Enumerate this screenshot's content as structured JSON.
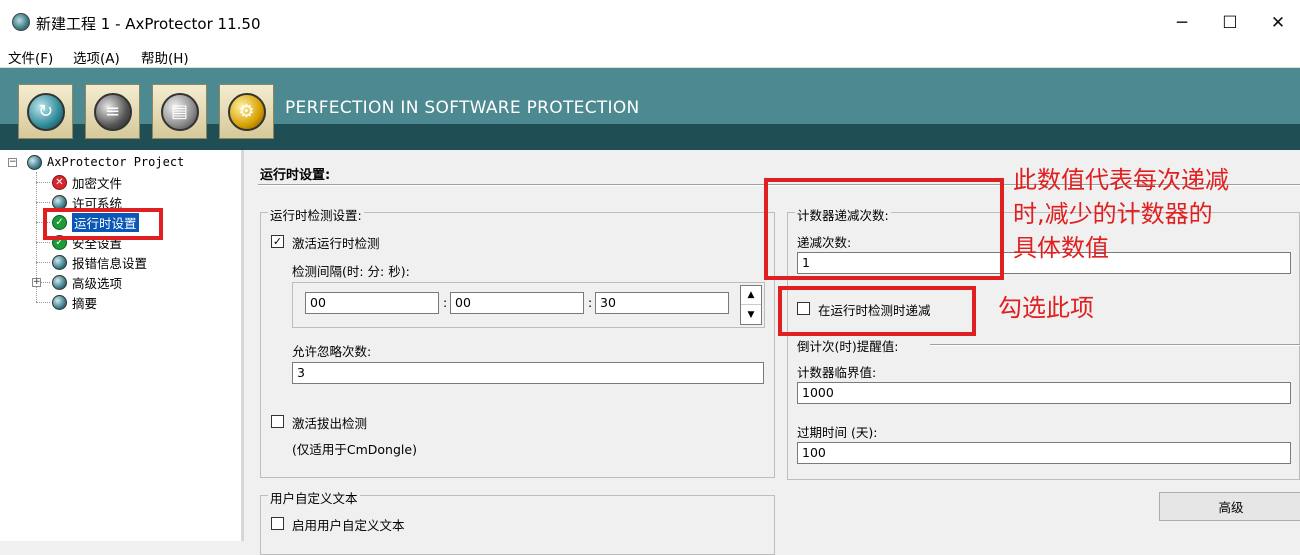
{
  "window": {
    "title": "新建工程 1 - AxProtector 11.50",
    "minimize": "─",
    "maximize": "☐",
    "close": "✕"
  },
  "menu": [
    {
      "label": "文件(F)"
    },
    {
      "label": "选项(A)"
    },
    {
      "label": "帮助(H)"
    }
  ],
  "banner": {
    "tagline": "PERFECTION IN SOFTWARE PROTECTION"
  },
  "tree": {
    "root": "AxProtector Project",
    "root_expander": "−",
    "items": [
      {
        "label": "加密文件",
        "icon": "error-icon"
      },
      {
        "label": "许可系统",
        "icon": "globe-icon"
      },
      {
        "label": "运行时设置",
        "icon": "check-icon"
      },
      {
        "label": "安全设置",
        "icon": "check-icon"
      },
      {
        "label": "报错信息设置",
        "icon": "globe-icon"
      },
      {
        "label": "高级选项",
        "icon": "globe-icon",
        "expander": "+"
      },
      {
        "label": "摘要",
        "icon": "globe-icon"
      }
    ]
  },
  "panel": {
    "title": "运行时设置:",
    "runtime_check": {
      "legend": "运行时检测设置:",
      "enable_label": "激活运行时检测",
      "enable_checked": "✓",
      "interval_label": "检测间隔(时: 分: 秒):",
      "hours": "00",
      "minutes": "00",
      "seconds": "30",
      "sep1": ":",
      "sep2": ":",
      "spin_up": "▲",
      "spin_down": "▼",
      "ignore_label": "允许忽略次数:",
      "ignore_value": "3",
      "unplug_label": "激活拔出检测",
      "unplug_note": "(仅适用于CmDongle)"
    },
    "user_text": {
      "legend": "用户自定义文本",
      "enable_label": "启用用户自定义文本"
    },
    "counter": {
      "legend": "计数器递减次数:",
      "decrement_label": "递减次数:",
      "decrement_value": "1",
      "decrement_on_check_label": "在运行时检测时递减"
    },
    "countdown": {
      "legend": "倒计次(时)提醒值:",
      "threshold_label": "计数器临界值:",
      "threshold_value": "1000",
      "expiry_label": "过期时间 (天):",
      "expiry_value": "100"
    },
    "advanced_button": "高级"
  },
  "annotations": {
    "counter_note": [
      "此数值代表每次递减",
      "时,减少的计数器的",
      "具体数值"
    ],
    "check_note": "勾选此项"
  },
  "colors": {
    "banner": "#4c8990",
    "banner_strip": "#1f4f55",
    "selection": "#0a57b8",
    "annotation": "#e02020"
  }
}
